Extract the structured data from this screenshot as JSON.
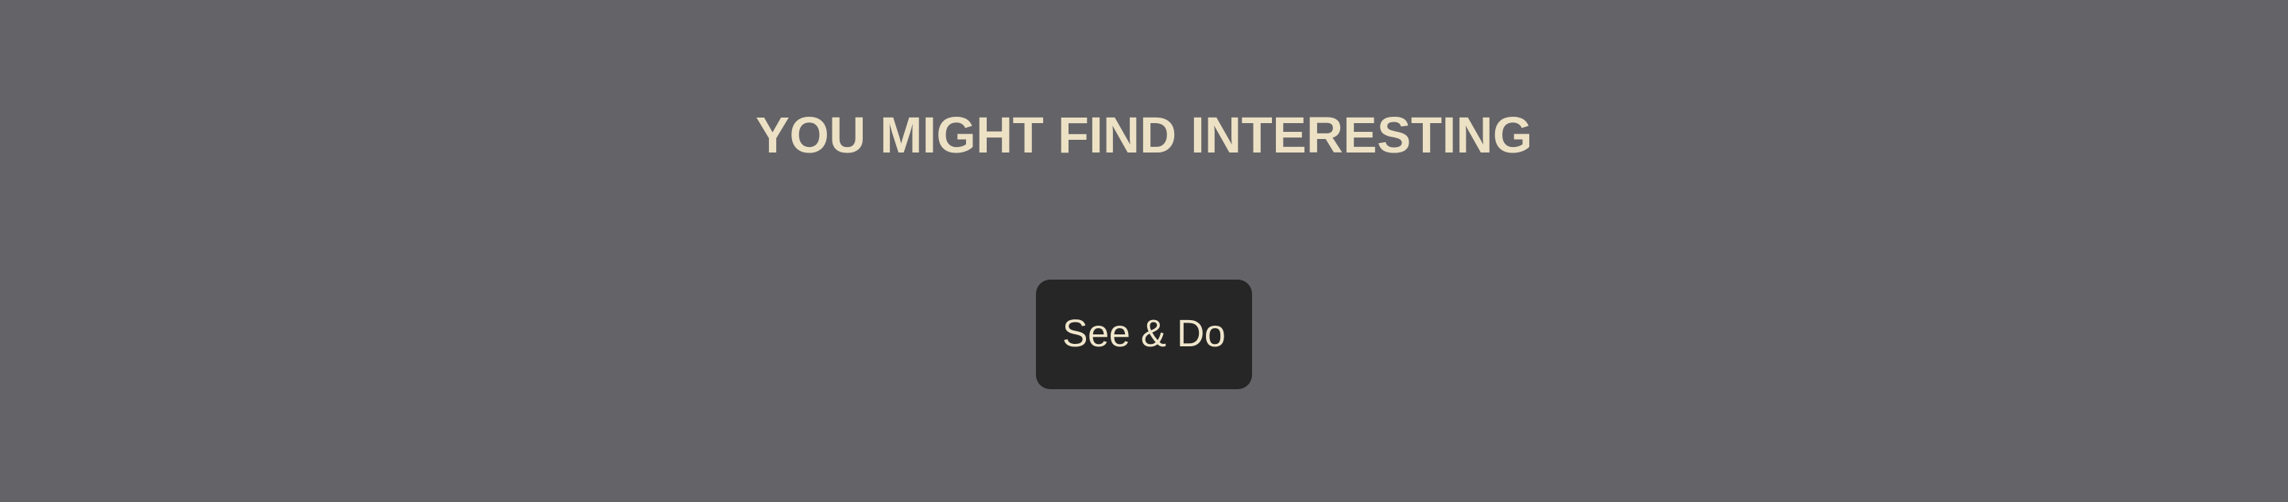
{
  "section": {
    "heading": "YOU MIGHT FIND INTERESTING",
    "button_label": "See & Do"
  },
  "colors": {
    "background": "#646368",
    "heading_text": "#ece1c4",
    "button_background": "#262626",
    "button_text": "#f0e6cc"
  }
}
